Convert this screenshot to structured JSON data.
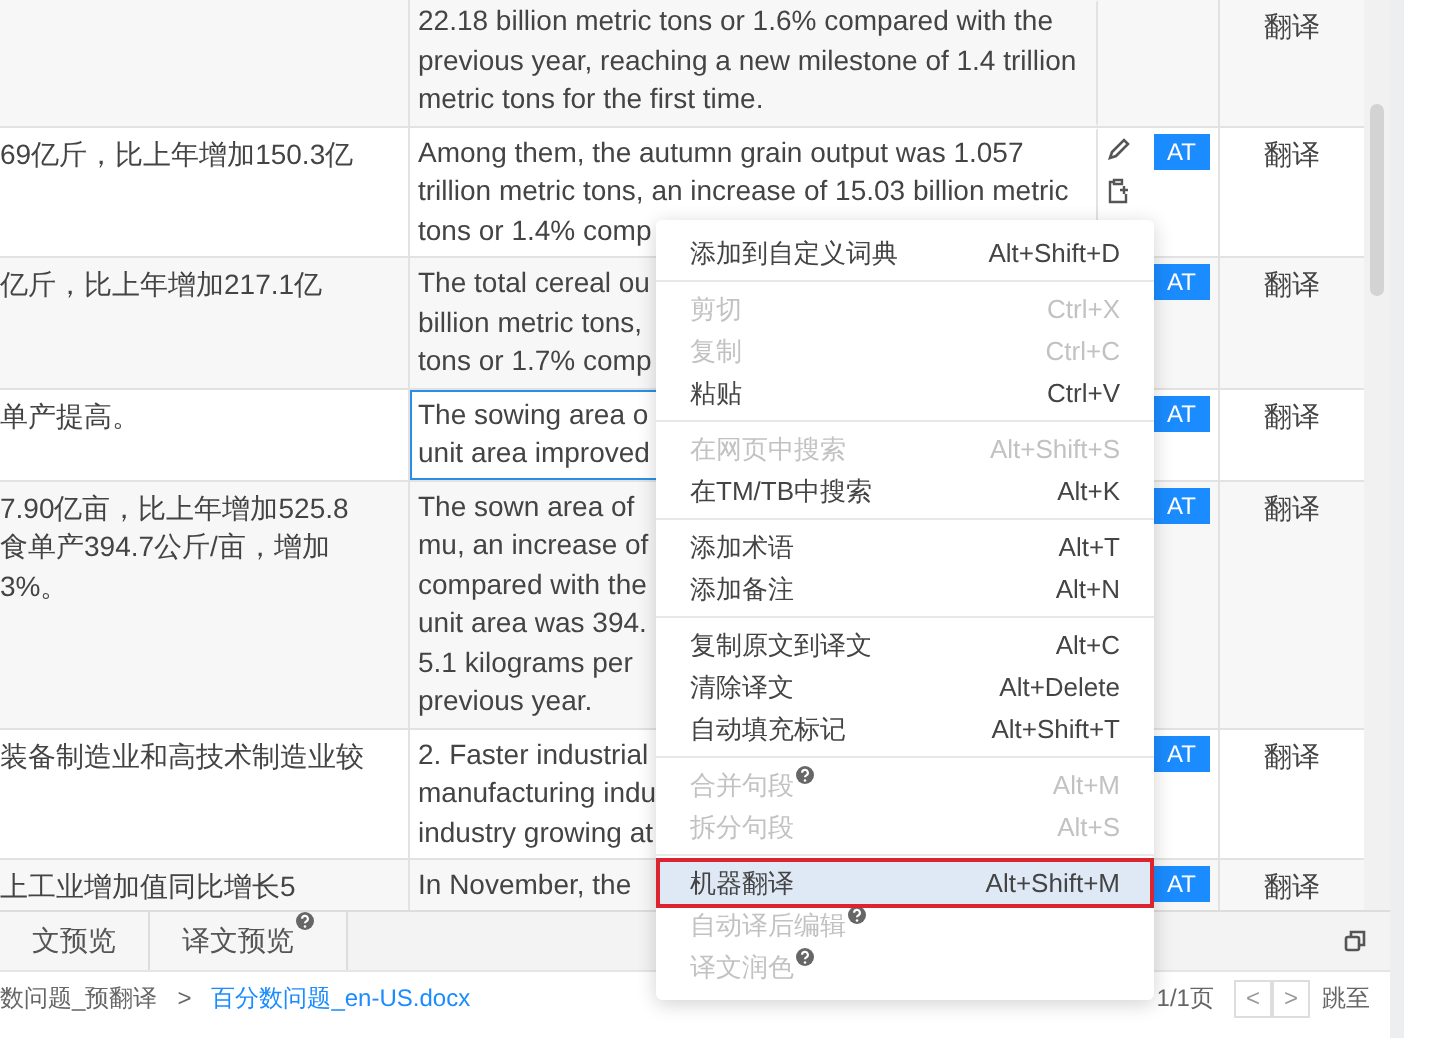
{
  "table": {
    "rows": [
      {
        "source_lines": [],
        "target_lines": [
          "22.18 billion metric tons or 1.6% compared with the",
          "previous year, reaching a new milestone of 1.4 trillion",
          "metric tons for the first time."
        ],
        "action": "翻译",
        "active": false,
        "edit_icons": false
      },
      {
        "source_lines": [
          "69亿斤，比上年增加150.3亿"
        ],
        "target_lines": [
          "Among them, the autumn grain output was 1.057",
          "trillion metric tons, an increase of 15.03 billion metric",
          "tons or 1.4% comp"
        ],
        "at_badge": "AT",
        "action": "翻译",
        "active": false,
        "edit_icons": true
      },
      {
        "source_lines": [
          "亿斤，比上年增加217.1亿"
        ],
        "target_lines": [
          "The total cereal ou",
          "billion metric tons,",
          "tons or 1.7% comp"
        ],
        "at_badge": "AT",
        "action": "翻译",
        "active": false,
        "edit_icons": false
      },
      {
        "source_lines": [
          "单产提高。"
        ],
        "target_lines": [
          "The sowing area o",
          "unit area improved"
        ],
        "at_badge": "AT",
        "action": "翻译",
        "active": true,
        "edit_icons": false
      },
      {
        "source_lines": [
          "7.90亿亩，比上年增加525.8",
          "食单产394.7公斤/亩，增加",
          "3%。"
        ],
        "target_lines": [
          "The sown area of",
          "mu, an increase of",
          "compared with the",
          "unit area was 394.",
          "5.1 kilograms per",
          "previous year."
        ],
        "at_badge": "AT",
        "action": "翻译",
        "active": false,
        "edit_icons": false
      },
      {
        "source_lines": [
          "装备制造业和高技术制造业较"
        ],
        "target_lines": [
          "2. Faster industrial",
          "manufacturing indu",
          "industry growing at"
        ],
        "at_badge": "AT",
        "action": "翻译",
        "active": false,
        "edit_icons": false
      },
      {
        "source_lines": [
          "上工业增加值同比增长5"
        ],
        "target_lines": [
          "In November, the"
        ],
        "at_badge": "AT",
        "action": "翻译",
        "active": false,
        "edit_icons": false
      }
    ]
  },
  "context_menu": {
    "groups": [
      [
        {
          "label": "添加到自定义词典",
          "shortcut": "Alt+Shift+D",
          "disabled": false,
          "help": false,
          "selected": false,
          "outlined": false
        }
      ],
      [
        {
          "label": "剪切",
          "shortcut": "Ctrl+X",
          "disabled": true,
          "help": false,
          "selected": false,
          "outlined": false
        },
        {
          "label": "复制",
          "shortcut": "Ctrl+C",
          "disabled": true,
          "help": false,
          "selected": false,
          "outlined": false
        },
        {
          "label": "粘贴",
          "shortcut": "Ctrl+V",
          "disabled": false,
          "help": false,
          "selected": false,
          "outlined": false
        }
      ],
      [
        {
          "label": "在网页中搜索",
          "shortcut": "Alt+Shift+S",
          "disabled": true,
          "help": false,
          "selected": false,
          "outlined": false
        },
        {
          "label": "在TM/TB中搜索",
          "shortcut": "Alt+K",
          "disabled": false,
          "help": false,
          "selected": false,
          "outlined": false
        }
      ],
      [
        {
          "label": "添加术语",
          "shortcut": "Alt+T",
          "disabled": false,
          "help": false,
          "selected": false,
          "outlined": false
        },
        {
          "label": "添加备注",
          "shortcut": "Alt+N",
          "disabled": false,
          "help": false,
          "selected": false,
          "outlined": false
        }
      ],
      [
        {
          "label": "复制原文到译文",
          "shortcut": "Alt+C",
          "disabled": false,
          "help": false,
          "selected": false,
          "outlined": false
        },
        {
          "label": "清除译文",
          "shortcut": "Alt+Delete",
          "disabled": false,
          "help": false,
          "selected": false,
          "outlined": false
        },
        {
          "label": "自动填充标记",
          "shortcut": "Alt+Shift+T",
          "disabled": false,
          "help": false,
          "selected": false,
          "outlined": false
        }
      ],
      [
        {
          "label": "合并句段",
          "shortcut": "Alt+M",
          "disabled": true,
          "help": true,
          "selected": false,
          "outlined": false
        },
        {
          "label": "拆分句段",
          "shortcut": "Alt+S",
          "disabled": true,
          "help": false,
          "selected": false,
          "outlined": false
        }
      ],
      [
        {
          "label": "机器翻译",
          "shortcut": "Alt+Shift+M",
          "disabled": false,
          "help": false,
          "selected": true,
          "outlined": true
        },
        {
          "label": "自动译后编辑",
          "disabled": true,
          "help": true,
          "selected": false,
          "outlined": false
        },
        {
          "label": "译文润色",
          "disabled": true,
          "help": true,
          "selected": false,
          "outlined": false
        }
      ]
    ]
  },
  "bottom_tabs": [
    {
      "label": "文预览",
      "help": false
    },
    {
      "label": "译文预览",
      "help": true
    }
  ],
  "breadcrumb": {
    "folder": "数问题_预翻译",
    "separator": ">",
    "file": "百分数问题_en-US.docx"
  },
  "pager": {
    "page": "1/1页",
    "prev": "<",
    "next": ">",
    "jump": "跳至"
  }
}
